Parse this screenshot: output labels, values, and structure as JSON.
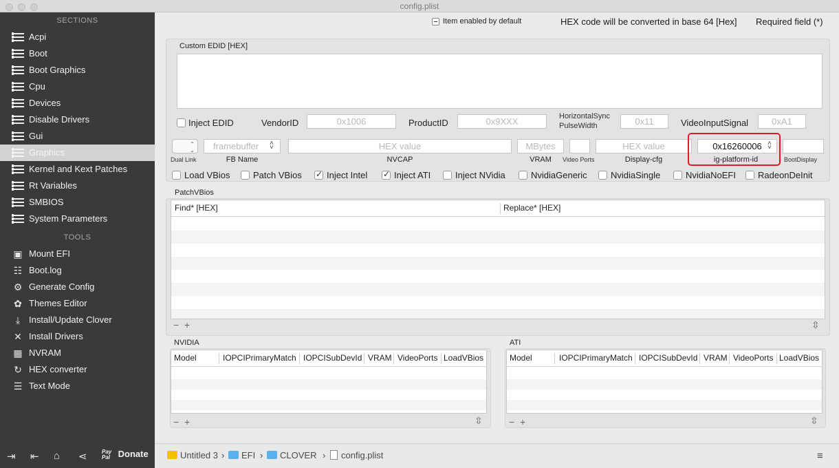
{
  "window": {
    "title": "config.plist"
  },
  "sidebar": {
    "sections_header": "SECTIONS",
    "sections": [
      {
        "label": "Acpi"
      },
      {
        "label": "Boot"
      },
      {
        "label": "Boot Graphics"
      },
      {
        "label": "Cpu"
      },
      {
        "label": "Devices"
      },
      {
        "label": "Disable Drivers"
      },
      {
        "label": "Gui"
      },
      {
        "label": "Graphics",
        "active": true
      },
      {
        "label": "Kernel and Kext Patches"
      },
      {
        "label": "Rt Variables"
      },
      {
        "label": "SMBIOS"
      },
      {
        "label": "System Parameters"
      }
    ],
    "tools_header": "TOOLS",
    "tools": [
      {
        "label": "Mount EFI",
        "icon": "disk-icon"
      },
      {
        "label": "Boot.log",
        "icon": "log-search-icon"
      },
      {
        "label": "Generate Config",
        "icon": "gears-icon"
      },
      {
        "label": "Themes Editor",
        "icon": "palette-icon"
      },
      {
        "label": "Install/Update Clover",
        "icon": "download-icon"
      },
      {
        "label": "Install Drivers",
        "icon": "wrench-icon"
      },
      {
        "label": "NVRAM",
        "icon": "chip-icon"
      },
      {
        "label": "HEX converter",
        "icon": "convert-icon"
      },
      {
        "label": "Text Mode",
        "icon": "text-icon"
      }
    ],
    "footer": {
      "donate_pay": "Pay Pal",
      "donate_label": "Donate"
    }
  },
  "topbar": {
    "item_enabled": "Item enabled by default",
    "hex_note": "HEX code will be converted in base 64 [Hex]",
    "required_note": "Required field (*)"
  },
  "edid": {
    "label": "Custom EDID [HEX]",
    "inject_edid": "Inject EDID",
    "vendor_label": "VendorID",
    "vendor_placeholder": "0x1006",
    "product_label": "ProductID",
    "product_placeholder": "0x9XXX",
    "hsync_label_1": "HorizontalSync",
    "hsync_label_2": "PulseWidth",
    "hsync_placeholder": "0x11",
    "vis_label": "VideoInputSignal",
    "vis_placeholder": "0xA1"
  },
  "graphics_row": {
    "dual_link": "Dual Link",
    "fb_placeholder": "framebuffer",
    "fb_name": "FB Name",
    "nvcap_placeholder": "HEX value",
    "nvcap": "NVCAP",
    "vram_placeholder": "MBytes",
    "vram": "VRAM",
    "video_ports": "Video Ports",
    "display_cfg_placeholder": "HEX value",
    "display_cfg": "Display-cfg",
    "ig_platform_value": "0x16260006",
    "ig_platform_label": "ig-platform-id",
    "boot_display": "BootDisplay"
  },
  "checkboxes": [
    {
      "label": "Load VBios",
      "checked": false
    },
    {
      "label": "Patch VBios",
      "checked": false
    },
    {
      "label": "Inject Intel",
      "checked": true
    },
    {
      "label": "Inject ATI",
      "checked": true
    },
    {
      "label": "Inject NVidia",
      "checked": false
    },
    {
      "label": "NvidiaGeneric",
      "checked": false
    },
    {
      "label": "NvidiaSingle",
      "checked": false
    },
    {
      "label": "NvidiaNoEFI",
      "checked": false
    },
    {
      "label": "RadeonDeInit",
      "checked": false
    }
  ],
  "patch_vbios": {
    "label": "PatchVBios",
    "col_find": "Find* [HEX]",
    "col_replace": "Replace* [HEX]"
  },
  "nvidia": {
    "label": "NVIDIA",
    "cols": [
      "Model",
      "IOPCIPrimaryMatch",
      "IOPCISubDevId",
      "VRAM",
      "VideoPorts",
      "LoadVBios"
    ]
  },
  "ati": {
    "label": "ATI",
    "cols": [
      "Model",
      "IOPCIPrimaryMatch",
      "IOPCISubDevId",
      "VRAM",
      "VideoPorts",
      "LoadVBios"
    ]
  },
  "breadcrumb": [
    "Untitled 3",
    "EFI",
    "CLOVER",
    "config.plist"
  ],
  "accent_highlight": "#e3182a"
}
